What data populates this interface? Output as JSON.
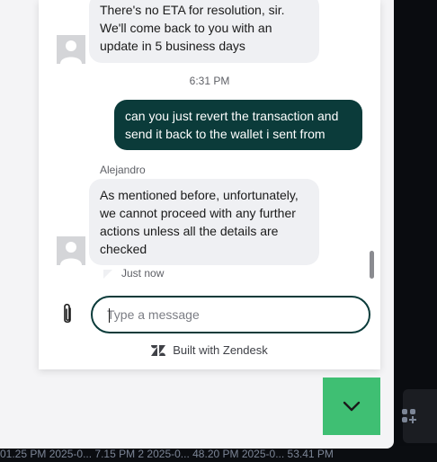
{
  "background": {
    "ticker_text": "01.25 PM   2025-0...   7.15 PM 2   2025-0...   48.20 PM   2025-0...   53.41 PM"
  },
  "chat": {
    "messages": [
      {
        "side": "incoming",
        "text": "There's no ETA for resolution, sir.\nWe'll come back to you with an\nupdate in 5 business days"
      },
      {
        "side": "timestamp",
        "text": "6:31 PM"
      },
      {
        "side": "outgoing",
        "text": "can you just revert the transaction and\nsend it back to the wallet i sent from"
      },
      {
        "side": "incoming",
        "sender": "Alejandro",
        "text": "As mentioned before, unfortunately,\nwe cannot proceed with any further\nactions unless all the details are\nchecked",
        "status": "Just now"
      }
    ],
    "composer": {
      "placeholder": "Type a message"
    },
    "footer": {
      "brand_text": "Built with Zendesk"
    }
  },
  "colors": {
    "outgoing_bubble": "#0b3b3a",
    "incoming_bubble": "#eff0f3",
    "launcher": "#3fbf73",
    "composer_border": "#0b3b3a"
  },
  "icons": {
    "attach": "paperclip-icon",
    "launcher": "chevron-down-icon",
    "brand": "zendesk-logo-icon",
    "avatar": "default-avatar-icon",
    "side": "grid-apps-icon"
  }
}
